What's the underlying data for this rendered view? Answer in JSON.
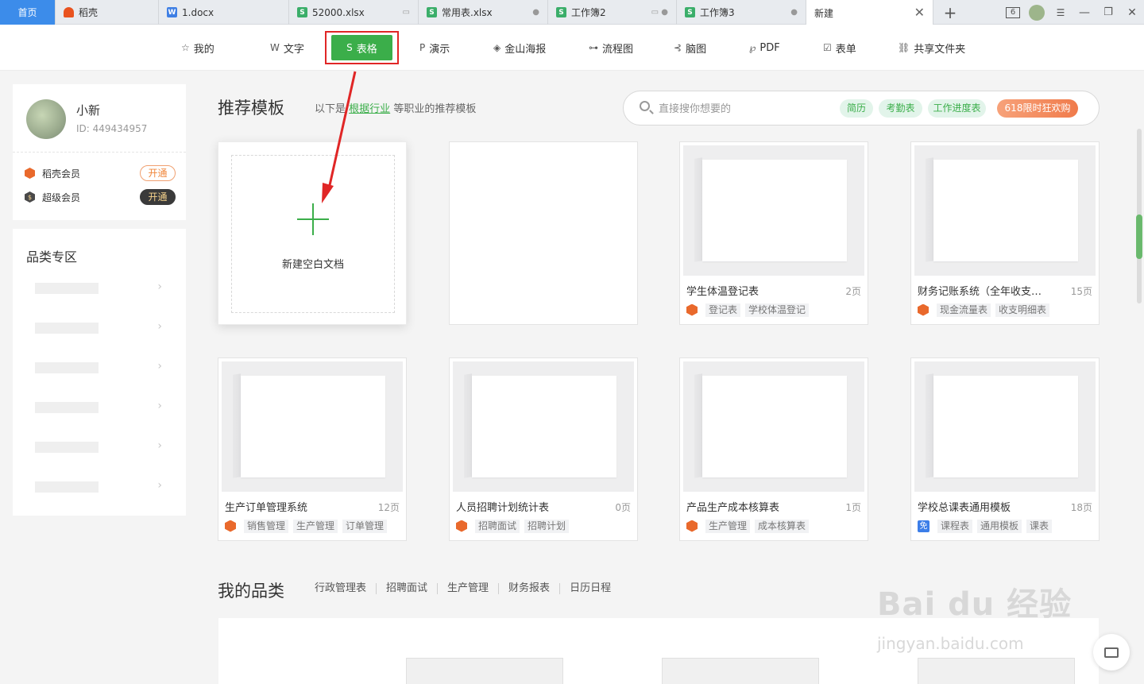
{
  "tabs": [
    {
      "label": "首页",
      "type": "home"
    },
    {
      "label": "稻壳",
      "icon": "daoke-icon",
      "icon_color": "#e9531f"
    },
    {
      "label": "1.docx",
      "icon": "word-icon",
      "icon_color": "#3f7fe4",
      "icon_letter": "W"
    },
    {
      "label": "52000.xlsx",
      "icon": "sheet-icon",
      "icon_color": "#3bae6a",
      "icon_letter": "S"
    },
    {
      "label": "常用表.xlsx",
      "icon": "sheet-icon",
      "icon_color": "#3bae6a",
      "icon_letter": "S"
    },
    {
      "label": "工作簿2",
      "icon": "sheet-icon",
      "icon_color": "#3bae6a",
      "icon_letter": "S"
    },
    {
      "label": "工作簿3",
      "icon": "sheet-icon",
      "icon_color": "#3bae6a",
      "icon_letter": "S"
    },
    {
      "label": "新建",
      "type": "active"
    }
  ],
  "window": {
    "tab_count": "6"
  },
  "nav": [
    {
      "label": "我的",
      "icon": "☆"
    },
    {
      "label": "文字",
      "icon": "W"
    },
    {
      "label": "表格",
      "icon": "S"
    },
    {
      "label": "演示",
      "icon": "P"
    },
    {
      "label": "金山海报",
      "icon": "◈"
    },
    {
      "label": "流程图",
      "icon": "⊶"
    },
    {
      "label": "脑图",
      "icon": "⊰"
    },
    {
      "label": "PDF",
      "icon": "℘"
    },
    {
      "label": "表单",
      "icon": "☑"
    },
    {
      "label": "共享文件夹",
      "icon": "⛓"
    }
  ],
  "user": {
    "name": "小新",
    "id": "ID: 449434957",
    "vip": [
      {
        "label": "稻壳会员",
        "button": "开通",
        "icon_color": "#e9692c"
      },
      {
        "label": "超级会员",
        "button": "开通",
        "icon_color": "#4a4a4a"
      }
    ]
  },
  "category_zone": {
    "title": "品类专区"
  },
  "recommend": {
    "title": "推荐模板",
    "sub_prefix": "以下是",
    "sub_link": "根据行业",
    "sub_suffix": "等职业的推荐模板"
  },
  "search": {
    "placeholder": "直接搜你想要的",
    "tags": [
      "简历",
      "考勤表",
      "工作进度表"
    ],
    "promo": "618限时狂欢购"
  },
  "new_blank": {
    "label": "新建空白文档"
  },
  "templates": [
    {
      "name": "学生体温登记表",
      "pages": "2页",
      "badge": "daoke",
      "tags": [
        "登记表",
        "学校体温登记"
      ]
    },
    {
      "name": "财务记账系统（全年收支管理...",
      "pages": "15页",
      "badge": "daoke",
      "tags": [
        "现金流量表",
        "收支明细表"
      ]
    },
    {
      "name": "生产订单管理系统",
      "pages": "12页",
      "badge": "daoke",
      "tags": [
        "销售管理",
        "生产管理",
        "订单管理"
      ]
    },
    {
      "name": "人员招聘计划统计表",
      "pages": "0页",
      "badge": "daoke",
      "tags": [
        "招聘面试",
        "招聘计划"
      ]
    },
    {
      "name": "产品生产成本核算表",
      "pages": "1页",
      "badge": "daoke",
      "tags": [
        "生产管理",
        "成本核算表"
      ]
    },
    {
      "name": "学校总课表通用模板",
      "pages": "18页",
      "badge": "free",
      "badge_text": "免",
      "tags": [
        "课程表",
        "通用模板",
        "课表"
      ]
    }
  ],
  "my_categories": {
    "title": "我的品类",
    "links": [
      "行政管理表",
      "招聘面试",
      "生产管理",
      "财务报表",
      "日历日程"
    ]
  },
  "watermark": {
    "line1": "Bai du 经验",
    "line2": "jingyan.baidu.com"
  },
  "colors": {
    "accent": "#3bae4a",
    "annotation": "#e02626",
    "tab_home": "#3c8cea"
  }
}
